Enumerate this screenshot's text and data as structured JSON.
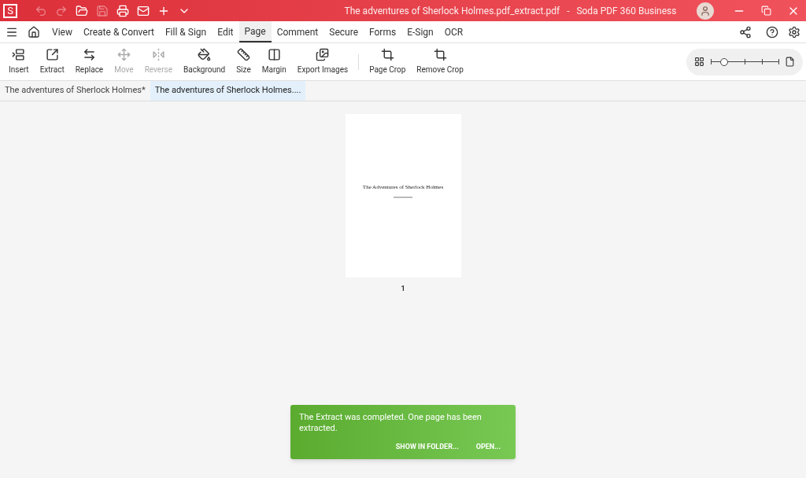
{
  "window": {
    "title": "The adventures of Sherlock Holmes.pdf_extract.pdf   -   Soda PDF 360 Business",
    "logo": "S"
  },
  "menu_tabs": [
    {
      "label": "View",
      "selected": false
    },
    {
      "label": "Create & Convert",
      "selected": false
    },
    {
      "label": "Fill & Sign",
      "selected": false
    },
    {
      "label": "Edit",
      "selected": false
    },
    {
      "label": "Page",
      "selected": true
    },
    {
      "label": "Comment",
      "selected": false
    },
    {
      "label": "Secure",
      "selected": false
    },
    {
      "label": "Forms",
      "selected": false
    },
    {
      "label": "E-Sign",
      "selected": false
    },
    {
      "label": "OCR",
      "selected": false
    }
  ],
  "ribbon": [
    {
      "kind": "insert",
      "label": "Insert",
      "disabled": false
    },
    {
      "kind": "extract",
      "label": "Extract",
      "disabled": false
    },
    {
      "kind": "replace",
      "label": "Replace",
      "disabled": false
    },
    {
      "kind": "move",
      "label": "Move",
      "disabled": true
    },
    {
      "kind": "reverse",
      "label": "Reverse",
      "disabled": true
    },
    {
      "kind": "background",
      "label": "Background",
      "disabled": false
    },
    {
      "kind": "size",
      "label": "Size",
      "disabled": false
    },
    {
      "kind": "margin",
      "label": "Margin",
      "disabled": false
    },
    {
      "kind": "export",
      "label": "Export Images",
      "disabled": false
    },
    {
      "kind": "separator"
    },
    {
      "kind": "crop",
      "label": "Page Crop",
      "disabled": false
    },
    {
      "kind": "uncrop",
      "label": "Remove Crop",
      "disabled": false
    }
  ],
  "zoom": {
    "level": 0.2
  },
  "doc_tabs": [
    {
      "label": "The adventures of Sherlock Holmes*",
      "selected": false
    },
    {
      "label": "The adventures of Sherlock Holmes....",
      "selected": true
    }
  ],
  "page": {
    "title": "The Adventures of Sherlock Holmes",
    "number": "1"
  },
  "toast": {
    "message": "The Extract was completed. One page has been extracted.",
    "actions": [
      "SHOW IN FOLDER...",
      "OPEN..."
    ]
  }
}
